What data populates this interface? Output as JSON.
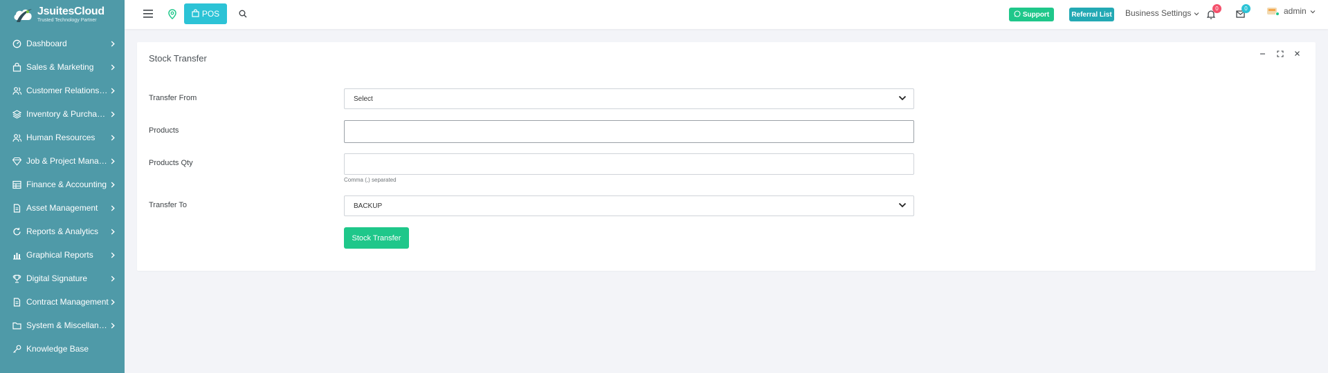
{
  "brand": {
    "name": "JsuitesCloud",
    "tagline": "Trusted Technology Partner"
  },
  "sidebar": {
    "items": [
      {
        "label": "Dashboard",
        "icon": "gauge-icon"
      },
      {
        "label": "Sales & Marketing",
        "icon": "shopping-bag-icon"
      },
      {
        "label": "Customer Relationshi...",
        "icon": "users-icon"
      },
      {
        "label": "Inventory & Purchasi...",
        "icon": "layers-icon"
      },
      {
        "label": "Human Resources",
        "icon": "users-icon"
      },
      {
        "label": "Job & Project Manag...",
        "icon": "diamond-icon"
      },
      {
        "label": "Finance & Accounting",
        "icon": "table-icon"
      },
      {
        "label": "Asset Management",
        "icon": "document-icon"
      },
      {
        "label": "Reports & Analytics",
        "icon": "refresh-icon"
      },
      {
        "label": "Graphical Reports",
        "icon": "bar-chart-icon"
      },
      {
        "label": "Digital Signature",
        "icon": "trophy-icon"
      },
      {
        "label": "Contract Management",
        "icon": "document-icon"
      },
      {
        "label": "System & Miscellaneo...",
        "icon": "folder-icon"
      },
      {
        "label": "Knowledge Base",
        "icon": "key-icon"
      }
    ]
  },
  "topbar": {
    "pos_label": "POS",
    "support_label": "Support",
    "referral_label": "Referral List",
    "business_settings_label": "Business Settings",
    "notifications_count": "0",
    "messages_count": "0",
    "user_name": "admin"
  },
  "card": {
    "title": "Stock Transfer",
    "fields": {
      "transfer_from_label": "Transfer From",
      "transfer_from_value": "Select",
      "products_label": "Products",
      "products_value": "",
      "products_qty_label": "Products Qty",
      "products_qty_value": "",
      "products_qty_hint": "Comma (,) separated",
      "transfer_to_label": "Transfer To",
      "transfer_to_value": "BACKUP"
    },
    "submit_label": "Stock Transfer"
  },
  "colors": {
    "sidebar_bg": "#4f9aa8",
    "pos_accent": "#2cc3d6",
    "support_green": "#1fc78a",
    "referral_teal": "#23a9b4",
    "notification_badge": "#f4516c",
    "message_badge": "#2cc3d6"
  }
}
